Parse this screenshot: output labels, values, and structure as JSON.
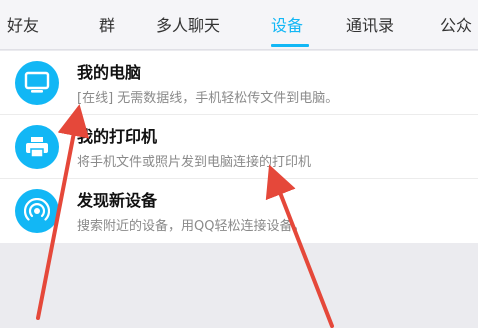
{
  "tabs": [
    {
      "label": "好友"
    },
    {
      "label": "群"
    },
    {
      "label": "多人聊天"
    },
    {
      "label": "设备"
    },
    {
      "label": "通讯录"
    },
    {
      "label": "公众"
    }
  ],
  "active_tab": "设备",
  "devices": [
    {
      "title": "我的电脑",
      "status": "[在线]",
      "subtitle": " 无需数据线，手机轻松传文件到电脑。",
      "icon": "monitor-icon"
    },
    {
      "title": "我的打印机",
      "subtitle": "将手机文件或照片发到电脑连接的打印机",
      "icon": "printer-icon"
    },
    {
      "title": "发现新设备",
      "subtitle": "搜索附近的设备，用QQ轻松连接设备。",
      "icon": "radar-icon"
    }
  ],
  "colors": {
    "accent": "#12b7f5",
    "annotation_arrow": "#e5483a"
  }
}
